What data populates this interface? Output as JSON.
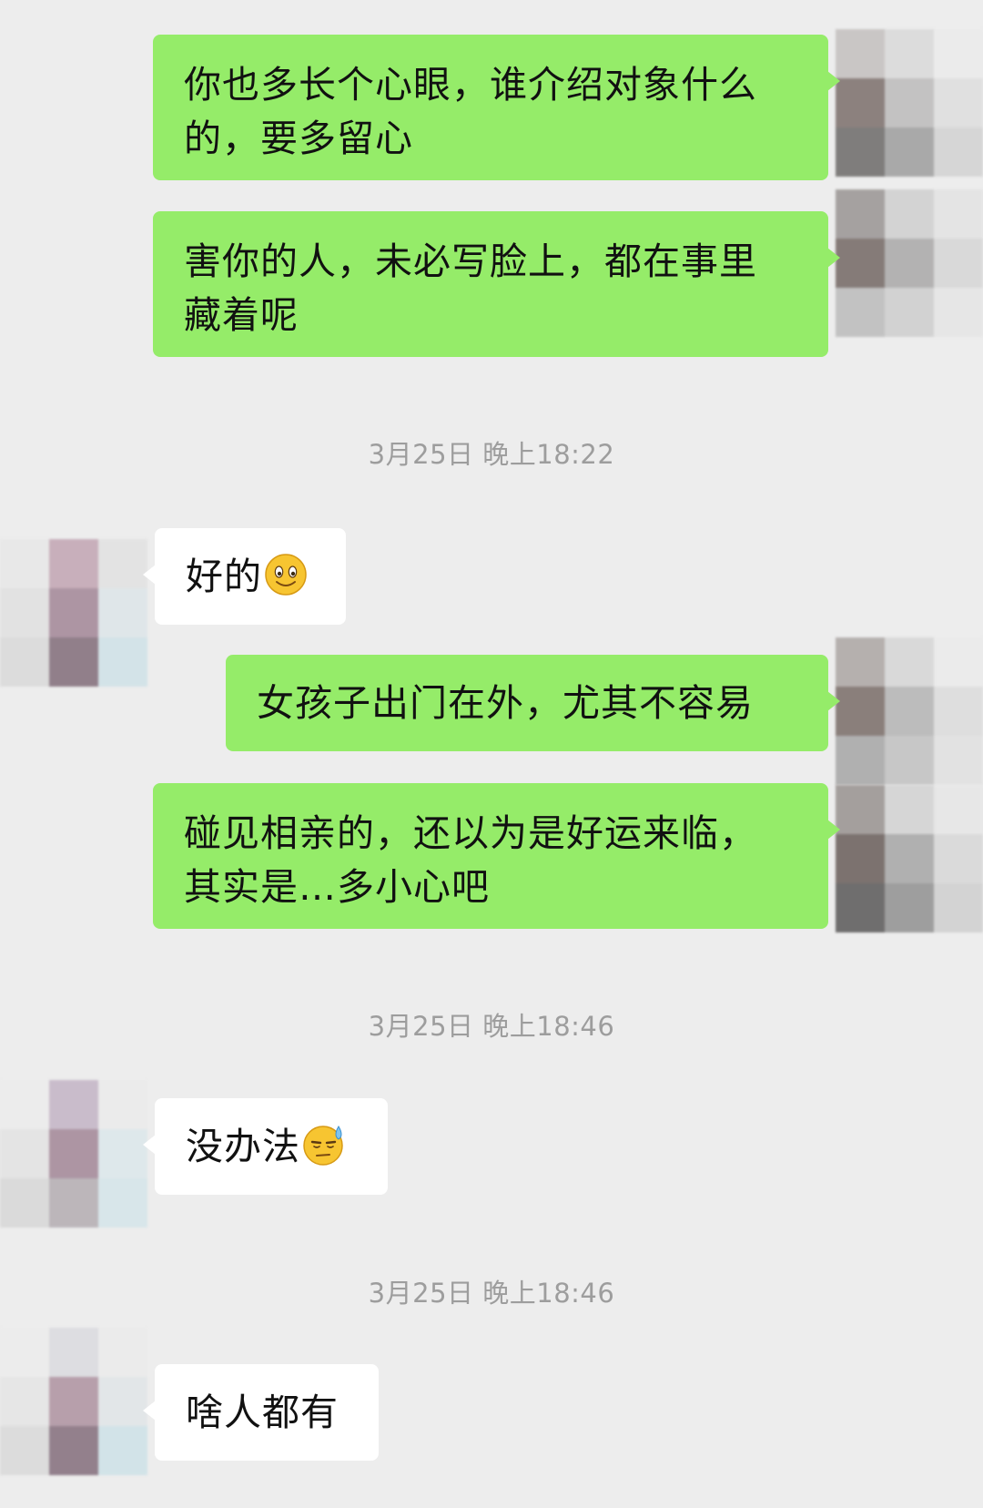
{
  "messages": [
    {
      "side": "sent",
      "text": "你也多长个心眼，谁介绍对象什么\n的，要多留心"
    },
    {
      "side": "sent",
      "text": "害你的人，未必写脸上，都在事里\n藏着呢"
    },
    {
      "side": "time",
      "text": "3月25日 晚上18:22"
    },
    {
      "side": "recv",
      "text": "好的",
      "emoji": "smile-emoji"
    },
    {
      "side": "sent",
      "text": "女孩子出门在外，尤其不容易"
    },
    {
      "side": "sent",
      "text": "碰见相亲的，还以为是好运来临，\n其实是…多小心吧"
    },
    {
      "side": "time",
      "text": "3月25日 晚上18:46"
    },
    {
      "side": "recv",
      "text": "没办法",
      "emoji": "sweat-emoji"
    },
    {
      "side": "time",
      "text": "3月25日 晚上18:46"
    },
    {
      "side": "recv",
      "text": "啥人都有"
    }
  ],
  "colors": {
    "background": "#ededed",
    "sent_bubble": "#95ec69",
    "received_bubble": "#ffffff",
    "timestamp_text": "#9d9d9d"
  },
  "avatars": {
    "self": "pixelated-self-avatar",
    "contact": "pixelated-contact-avatar"
  }
}
